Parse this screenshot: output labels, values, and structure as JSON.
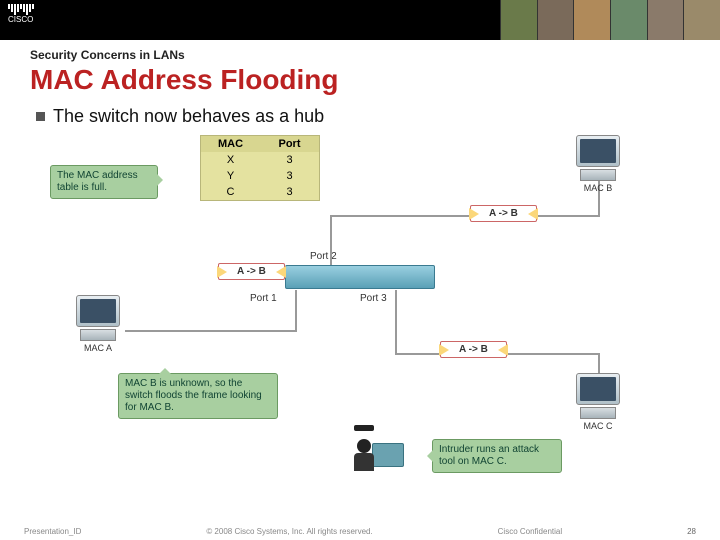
{
  "brand": "CISCO",
  "header": {
    "subtitle": "Security Concerns in LANs",
    "title": "MAC Address Flooding",
    "bullet": "The switch now behaves as a hub"
  },
  "mac_table": {
    "col1": "MAC",
    "col2": "Port",
    "rows": [
      {
        "mac": "X",
        "port": "3"
      },
      {
        "mac": "Y",
        "port": "3"
      },
      {
        "mac": "C",
        "port": "3"
      }
    ]
  },
  "callouts": {
    "full": "The MAC address table is full.",
    "unknown": "MAC B is unknown, so the switch floods the frame looking for MAC B.",
    "intruder": "Intruder runs an attack tool on MAC C."
  },
  "ports": {
    "p1": "Port 1",
    "p2": "Port 2",
    "p3": "Port 3"
  },
  "frame_label": "A -> B",
  "hosts": {
    "a": "MAC A",
    "b": "MAC B",
    "c": "MAC C"
  },
  "footer": {
    "left": "Presentation_ID",
    "center": "© 2008 Cisco Systems, Inc. All rights reserved.",
    "right": "Cisco Confidential",
    "page": "28"
  }
}
